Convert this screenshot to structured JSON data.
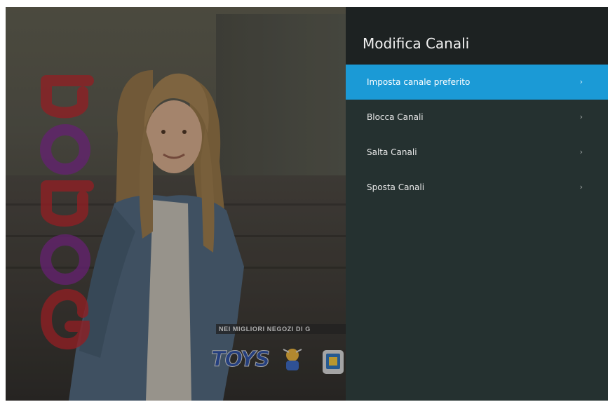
{
  "video": {
    "channel_logo": "GOPOP",
    "promo_text": "NEI MIGLIORI NEGOZI DI G",
    "toys_logo": "TOYS"
  },
  "panel": {
    "title": "Modifica Canali",
    "items": [
      {
        "label": "Imposta canale preferito",
        "selected": true
      },
      {
        "label": "Blocca Canali",
        "selected": false
      },
      {
        "label": "Salta Canali",
        "selected": false
      },
      {
        "label": "Sposta Canali",
        "selected": false
      }
    ],
    "accent_color": "#1b9ad6",
    "chevron_icon": "chevron-right-icon"
  }
}
